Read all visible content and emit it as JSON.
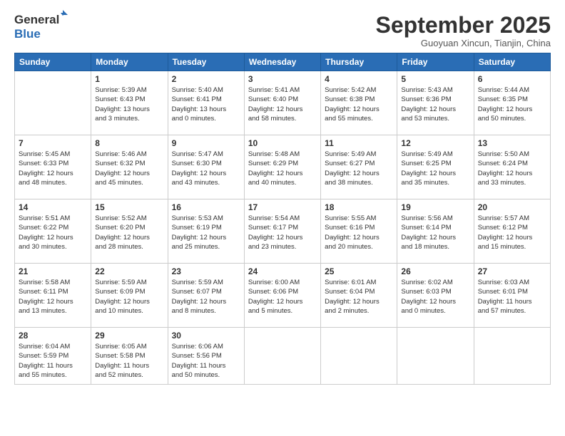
{
  "header": {
    "logo_general": "General",
    "logo_blue": "Blue",
    "month_title": "September 2025",
    "subtitle": "Guoyuan Xincun, Tianjin, China"
  },
  "weekdays": [
    "Sunday",
    "Monday",
    "Tuesday",
    "Wednesday",
    "Thursday",
    "Friday",
    "Saturday"
  ],
  "weeks": [
    [
      {
        "day": "",
        "info": ""
      },
      {
        "day": "1",
        "info": "Sunrise: 5:39 AM\nSunset: 6:43 PM\nDaylight: 13 hours\nand 3 minutes."
      },
      {
        "day": "2",
        "info": "Sunrise: 5:40 AM\nSunset: 6:41 PM\nDaylight: 13 hours\nand 0 minutes."
      },
      {
        "day": "3",
        "info": "Sunrise: 5:41 AM\nSunset: 6:40 PM\nDaylight: 12 hours\nand 58 minutes."
      },
      {
        "day": "4",
        "info": "Sunrise: 5:42 AM\nSunset: 6:38 PM\nDaylight: 12 hours\nand 55 minutes."
      },
      {
        "day": "5",
        "info": "Sunrise: 5:43 AM\nSunset: 6:36 PM\nDaylight: 12 hours\nand 53 minutes."
      },
      {
        "day": "6",
        "info": "Sunrise: 5:44 AM\nSunset: 6:35 PM\nDaylight: 12 hours\nand 50 minutes."
      }
    ],
    [
      {
        "day": "7",
        "info": "Sunrise: 5:45 AM\nSunset: 6:33 PM\nDaylight: 12 hours\nand 48 minutes."
      },
      {
        "day": "8",
        "info": "Sunrise: 5:46 AM\nSunset: 6:32 PM\nDaylight: 12 hours\nand 45 minutes."
      },
      {
        "day": "9",
        "info": "Sunrise: 5:47 AM\nSunset: 6:30 PM\nDaylight: 12 hours\nand 43 minutes."
      },
      {
        "day": "10",
        "info": "Sunrise: 5:48 AM\nSunset: 6:29 PM\nDaylight: 12 hours\nand 40 minutes."
      },
      {
        "day": "11",
        "info": "Sunrise: 5:49 AM\nSunset: 6:27 PM\nDaylight: 12 hours\nand 38 minutes."
      },
      {
        "day": "12",
        "info": "Sunrise: 5:49 AM\nSunset: 6:25 PM\nDaylight: 12 hours\nand 35 minutes."
      },
      {
        "day": "13",
        "info": "Sunrise: 5:50 AM\nSunset: 6:24 PM\nDaylight: 12 hours\nand 33 minutes."
      }
    ],
    [
      {
        "day": "14",
        "info": "Sunrise: 5:51 AM\nSunset: 6:22 PM\nDaylight: 12 hours\nand 30 minutes."
      },
      {
        "day": "15",
        "info": "Sunrise: 5:52 AM\nSunset: 6:20 PM\nDaylight: 12 hours\nand 28 minutes."
      },
      {
        "day": "16",
        "info": "Sunrise: 5:53 AM\nSunset: 6:19 PM\nDaylight: 12 hours\nand 25 minutes."
      },
      {
        "day": "17",
        "info": "Sunrise: 5:54 AM\nSunset: 6:17 PM\nDaylight: 12 hours\nand 23 minutes."
      },
      {
        "day": "18",
        "info": "Sunrise: 5:55 AM\nSunset: 6:16 PM\nDaylight: 12 hours\nand 20 minutes."
      },
      {
        "day": "19",
        "info": "Sunrise: 5:56 AM\nSunset: 6:14 PM\nDaylight: 12 hours\nand 18 minutes."
      },
      {
        "day": "20",
        "info": "Sunrise: 5:57 AM\nSunset: 6:12 PM\nDaylight: 12 hours\nand 15 minutes."
      }
    ],
    [
      {
        "day": "21",
        "info": "Sunrise: 5:58 AM\nSunset: 6:11 PM\nDaylight: 12 hours\nand 13 minutes."
      },
      {
        "day": "22",
        "info": "Sunrise: 5:59 AM\nSunset: 6:09 PM\nDaylight: 12 hours\nand 10 minutes."
      },
      {
        "day": "23",
        "info": "Sunrise: 5:59 AM\nSunset: 6:07 PM\nDaylight: 12 hours\nand 8 minutes."
      },
      {
        "day": "24",
        "info": "Sunrise: 6:00 AM\nSunset: 6:06 PM\nDaylight: 12 hours\nand 5 minutes."
      },
      {
        "day": "25",
        "info": "Sunrise: 6:01 AM\nSunset: 6:04 PM\nDaylight: 12 hours\nand 2 minutes."
      },
      {
        "day": "26",
        "info": "Sunrise: 6:02 AM\nSunset: 6:03 PM\nDaylight: 12 hours\nand 0 minutes."
      },
      {
        "day": "27",
        "info": "Sunrise: 6:03 AM\nSunset: 6:01 PM\nDaylight: 11 hours\nand 57 minutes."
      }
    ],
    [
      {
        "day": "28",
        "info": "Sunrise: 6:04 AM\nSunset: 5:59 PM\nDaylight: 11 hours\nand 55 minutes."
      },
      {
        "day": "29",
        "info": "Sunrise: 6:05 AM\nSunset: 5:58 PM\nDaylight: 11 hours\nand 52 minutes."
      },
      {
        "day": "30",
        "info": "Sunrise: 6:06 AM\nSunset: 5:56 PM\nDaylight: 11 hours\nand 50 minutes."
      },
      {
        "day": "",
        "info": ""
      },
      {
        "day": "",
        "info": ""
      },
      {
        "day": "",
        "info": ""
      },
      {
        "day": "",
        "info": ""
      }
    ]
  ]
}
